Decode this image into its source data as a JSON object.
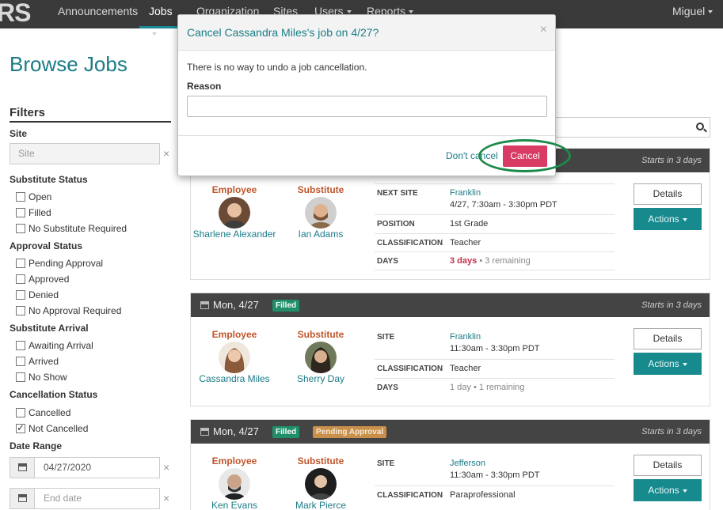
{
  "nav": {
    "logo": "RS",
    "items": [
      {
        "label": "Announcements",
        "caret": false
      },
      {
        "label": "Jobs",
        "caret": true
      },
      {
        "label": "Organization",
        "caret": false
      },
      {
        "label": "Sites",
        "caret": false
      },
      {
        "label": "Users",
        "caret": true
      },
      {
        "label": "Reports",
        "caret": true
      }
    ],
    "user": "Miguel"
  },
  "page": {
    "title": "Browse Jobs"
  },
  "filters": {
    "heading": "Filters",
    "site_label": "Site",
    "site_placeholder": "Site",
    "substitute_status": {
      "label": "Substitute Status",
      "options": [
        {
          "label": "Open",
          "checked": false
        },
        {
          "label": "Filled",
          "checked": false
        },
        {
          "label": "No Substitute Required",
          "checked": false
        }
      ]
    },
    "approval_status": {
      "label": "Approval Status",
      "options": [
        {
          "label": "Pending Approval",
          "checked": false
        },
        {
          "label": "Approved",
          "checked": false
        },
        {
          "label": "Denied",
          "checked": false
        },
        {
          "label": "No Approval Required",
          "checked": false
        }
      ]
    },
    "substitute_arrival": {
      "label": "Substitute Arrival",
      "options": [
        {
          "label": "Awaiting Arrival",
          "checked": false
        },
        {
          "label": "Arrived",
          "checked": false
        },
        {
          "label": "No Show",
          "checked": false
        }
      ]
    },
    "cancellation_status": {
      "label": "Cancellation Status",
      "options": [
        {
          "label": "Cancelled",
          "checked": false
        },
        {
          "label": "Not Cancelled",
          "checked": true
        }
      ]
    },
    "date_range": {
      "label": "Date Range",
      "start": "04/27/2020",
      "end_placeholder": "End date"
    },
    "clear_symbol": "×"
  },
  "jobs": [
    {
      "starts": "Starts in 3 days",
      "employee_label": "Employee",
      "substitute_label": "Substitute",
      "employee": "Sharlene Alexander",
      "substitute": "Ian Adams",
      "rows": [
        {
          "label": "NEXT SITE",
          "value": "Franklin",
          "value2": "4/27, 7:30am - 3:30pm PDT"
        },
        {
          "label": "POSITION",
          "value": "1st Grade"
        },
        {
          "label": "CLASSIFICATION",
          "value": "Teacher"
        },
        {
          "label": "DAYS",
          "value": "3 days",
          "value2": "3 remaining"
        }
      ],
      "details": "Details",
      "actions": "Actions"
    },
    {
      "date": "Mon, 4/27",
      "badges": [
        "Filled"
      ],
      "starts": "Starts in 3 days",
      "employee_label": "Employee",
      "substitute_label": "Substitute",
      "employee": "Cassandra Miles",
      "substitute": "Sherry Day",
      "rows": [
        {
          "label": "SITE",
          "value": "Franklin",
          "value2": "11:30am - 3:30pm PDT"
        },
        {
          "label": "CLASSIFICATION",
          "value": "Teacher"
        },
        {
          "label": "DAYS",
          "value": "1 day",
          "value2": "1 remaining"
        }
      ],
      "details": "Details",
      "actions": "Actions"
    },
    {
      "date": "Mon, 4/27",
      "badges": [
        "Filled",
        "Pending Approval"
      ],
      "starts": "Starts in 3 days",
      "employee_label": "Employee",
      "substitute_label": "Substitute",
      "employee": "Ken Evans",
      "substitute": "Mark Pierce",
      "rows": [
        {
          "label": "SITE",
          "value": "Jefferson",
          "value2": "11:30am - 3:30pm PDT"
        },
        {
          "label": "CLASSIFICATION",
          "value": "Paraprofessional"
        }
      ],
      "details": "Details",
      "actions": "Actions"
    }
  ],
  "modal": {
    "title": "Cancel Cassandra Miles's job on 4/27?",
    "close": "×",
    "warning": "There is no way to undo a job cancellation.",
    "reason_label": "Reason",
    "reason_value": "",
    "dont_cancel": "Don't cancel",
    "cancel": "Cancel"
  },
  "colors": {
    "accent": "#1a7c87",
    "danger": "#d83b64",
    "nav_bg": "#3a3a3a",
    "highlight": "#1d8a4a"
  }
}
